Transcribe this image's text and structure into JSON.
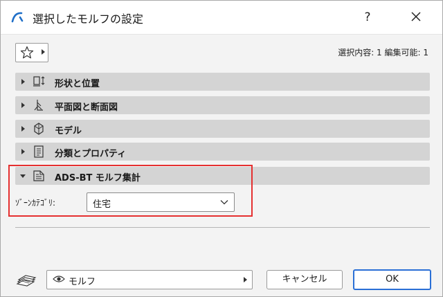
{
  "window": {
    "title": "選択したモルフの設定",
    "help_label": "?"
  },
  "selection_info": "選択内容: 1 編集可能: 1",
  "sections": [
    {
      "label": "形状と位置",
      "icon": "shape-position-icon",
      "expanded": false
    },
    {
      "label": "平面図と断面図",
      "icon": "floor-plan-section-icon",
      "expanded": false
    },
    {
      "label": "モデル",
      "icon": "model-icon",
      "expanded": false
    },
    {
      "label": "分類とプロパティ",
      "icon": "classification-icon",
      "expanded": false
    },
    {
      "label": "ADS-BT モルフ集計",
      "icon": "morph-schedule-icon",
      "expanded": true
    }
  ],
  "zone_category": {
    "label": "ｿﾞｰﾝｶﾃｺﾞﾘ:",
    "value": "住宅"
  },
  "footer": {
    "layer_value": "モルフ",
    "cancel_label": "キャンセル",
    "ok_label": "OK"
  },
  "colors": {
    "highlight": "#e53030",
    "ok_border": "#2a6fd6",
    "header_bar": "#d4d4d4",
    "app_accent": "#1f6fc8"
  }
}
